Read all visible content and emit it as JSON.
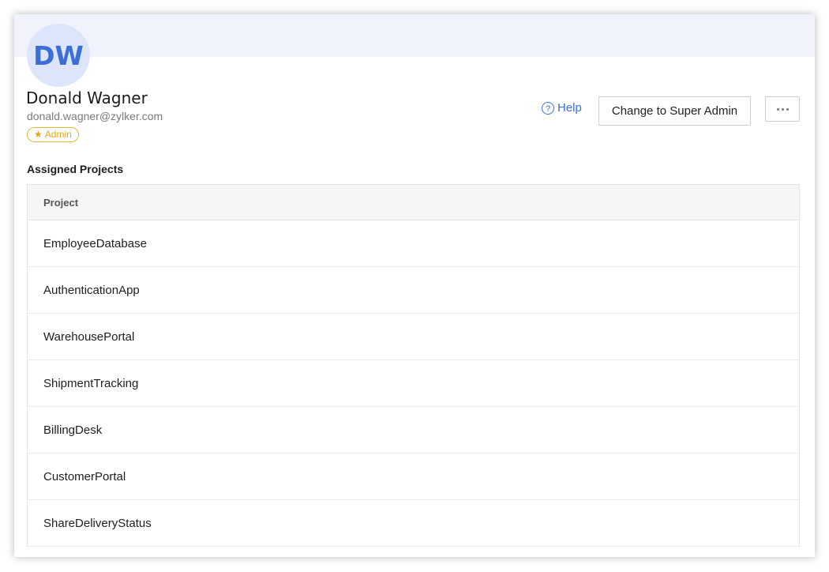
{
  "profile": {
    "initials": "DW",
    "name": "Donald Wagner",
    "email": "donald.wagner@zylker.com",
    "role_badge": "Admin",
    "role_icon": "star-icon"
  },
  "actions": {
    "help_icon": "question-circle-icon",
    "help_label": "Help",
    "change_role_label": "Change to Super Admin",
    "more_icon": "ellipsis-icon"
  },
  "projects": {
    "section_title": "Assigned Projects",
    "column_header": "Project",
    "rows": [
      "EmployeeDatabase",
      "AuthenticationApp",
      "WarehousePortal",
      "ShipmentTracking",
      "BillingDesk",
      "CustomerPortal",
      "ShareDeliveryStatus"
    ]
  },
  "colors": {
    "accent": "#3b6fd6",
    "avatar_bg": "#dce5fa",
    "banner_bg": "#f1f3fc",
    "badge": "#e0a81e"
  }
}
